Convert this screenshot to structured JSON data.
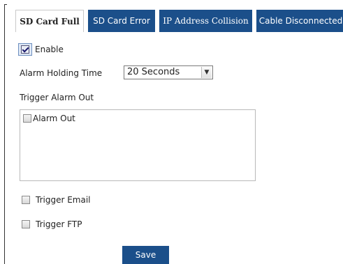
{
  "tabs": [
    {
      "label": "SD Card Full",
      "active": true
    },
    {
      "label": "SD Card Error",
      "active": false
    },
    {
      "label": "IP Address Collision",
      "active": false
    },
    {
      "label": "Cable Disconnected",
      "active": false
    }
  ],
  "form": {
    "enable_label": "Enable",
    "enable_checked": true,
    "alarm_holding_time_label": "Alarm Holding Time",
    "alarm_holding_time_value": "20 Seconds",
    "trigger_alarm_out_label": "Trigger Alarm Out",
    "alarm_out_label": "Alarm Out",
    "trigger_email_label": "Trigger Email",
    "trigger_ftp_label": "Trigger FTP",
    "save_label": "Save"
  },
  "colors": {
    "tab_inactive_bg": "#1b4f8a",
    "save_button_bg": "#1b4f8a"
  }
}
